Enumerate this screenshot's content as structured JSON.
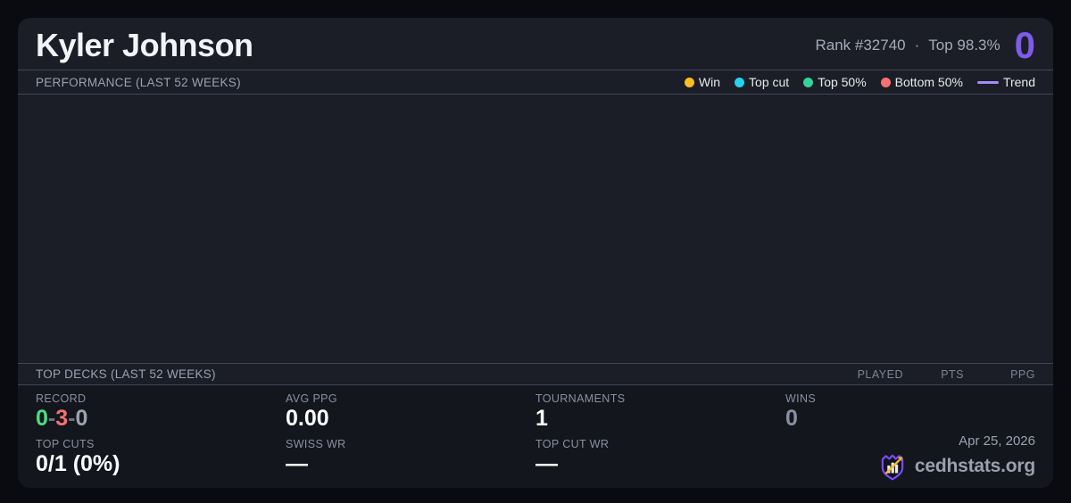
{
  "colors": {
    "page_bg": "#0a0b10",
    "card_bg": "#1b1e27",
    "band_bg": "#14161e",
    "divider": "#414659",
    "accent_purple": "#7e5ce8",
    "win_yellow": "#fbbf24",
    "topcut_cyan": "#22d3ee",
    "top50_green": "#34d399",
    "bottom50_red": "#f87171",
    "trend_purple": "#a78bfa",
    "record_win_green": "#4ade80",
    "record_loss_red": "#f87171"
  },
  "header": {
    "title": "Kyler Johnson",
    "rank_label": "Rank #32740",
    "separator": "·",
    "top_percent": "Top 98.3%",
    "points": "0"
  },
  "performance": {
    "label": "PERFORMANCE (LAST 52 WEEKS)",
    "legend": [
      {
        "label": "Win",
        "color": "#fbbf24",
        "swatch": "dot"
      },
      {
        "label": "Top cut",
        "color": "#22d3ee",
        "swatch": "dot"
      },
      {
        "label": "Top 50%",
        "color": "#34d399",
        "swatch": "dot"
      },
      {
        "label": "Bottom 50%",
        "color": "#f87171",
        "swatch": "dot"
      },
      {
        "label": "Trend",
        "color": "#a78bfa",
        "swatch": "line"
      }
    ],
    "chart_points": []
  },
  "top_decks": {
    "label": "TOP DECKS (LAST 52 WEEKS)",
    "columns": [
      "PLAYED",
      "PTS",
      "PPG"
    ],
    "rows": []
  },
  "stats": {
    "record": {
      "label": "RECORD",
      "wins": "0",
      "losses": "3",
      "draws": "0",
      "sep": "-"
    },
    "avg_ppg": {
      "label": "AVG PPG",
      "value": "0.00"
    },
    "tournaments": {
      "label": "TOURNAMENTS",
      "value": "1"
    },
    "wins": {
      "label": "WINS",
      "value": "0"
    },
    "top_cuts": {
      "label": "TOP CUTS",
      "value": "0/1 (0%)"
    },
    "swiss_wr": {
      "label": "SWISS WR",
      "value": "—"
    },
    "top_cut_wr": {
      "label": "TOP CUT WR",
      "value": "—"
    }
  },
  "brand": {
    "date": "Apr 25, 2026",
    "site": "cedhstats.org"
  }
}
